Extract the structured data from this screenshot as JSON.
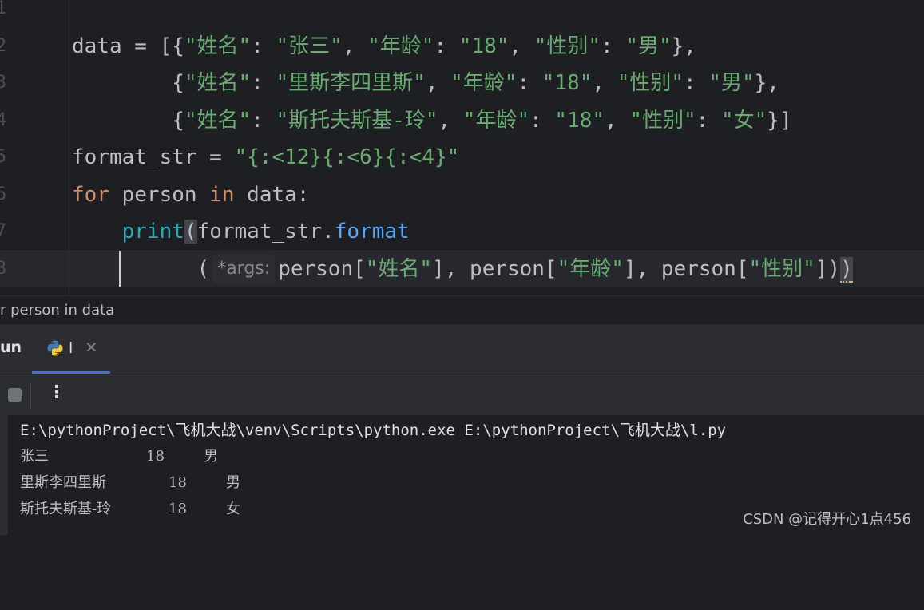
{
  "editor": {
    "line_numbers": [
      "1",
      "2",
      "3",
      "4",
      "5",
      "6",
      "7",
      "8"
    ],
    "code": {
      "l2": {
        "p1": "data = [{",
        "k1": "\"姓名\"",
        "c1": ": ",
        "v1": "\"张三\"",
        "c2": ", ",
        "k2": "\"年龄\"",
        "c3": ": ",
        "v2": "\"18\"",
        "c4": ", ",
        "k3": "\"性别\"",
        "c5": ": ",
        "v3": "\"男\"",
        "c6": "},"
      },
      "l3": {
        "p1": "        {",
        "k1": "\"姓名\"",
        "c1": ": ",
        "v1": "\"里斯李四里斯\"",
        "c2": ", ",
        "k2": "\"年龄\"",
        "c3": ": ",
        "v2": "\"18\"",
        "c4": ", ",
        "k3": "\"性别\"",
        "c5": ": ",
        "v3": "\"男\"",
        "c6": "},"
      },
      "l4": {
        "p1": "        {",
        "k1": "\"姓名\"",
        "c1": ": ",
        "v1": "\"斯托夫斯基-玲\"",
        "c2": ", ",
        "k2": "\"年龄\"",
        "c3": ": ",
        "v2": "\"18\"",
        "c4": ", ",
        "k3": "\"性别\"",
        "c5": ": ",
        "v3": "\"女\"",
        "c6": "}]"
      },
      "l5": {
        "p1": "format_str = ",
        "s1": "\"{:<12}{:<6}{:<4}\""
      },
      "l6": {
        "kw1": "for",
        "p1": " person ",
        "kw2": "in",
        "p2": " data:"
      },
      "l7": {
        "indent": "    ",
        "fn": "print",
        "paren": "(",
        "p1": "format_str.",
        "m1": "format"
      },
      "l8": {
        "indent": "          ",
        "p1": "(",
        "hint": "*args:",
        "p2": "person[",
        "s1": "\"姓名\"",
        "p3": "], person[",
        "s2": "\"年龄\"",
        "p4": "], person[",
        "s3": "\"性别\"",
        "p5": "]",
        "p6": ")",
        "p7": ")"
      }
    }
  },
  "breadcrumb": {
    "text": "r person in data"
  },
  "toolwindow": {
    "run_label": "un",
    "tab_name": "l",
    "tab_close": "✕"
  },
  "toolbar": {
    "more": "⋮"
  },
  "console": {
    "command": "E:\\pythonProject\\飞机大战\\venv\\Scripts\\python.exe E:\\pythonProject\\飞机大战\\l.py",
    "rows": [
      {
        "name": "张三",
        "age": "18",
        "gender": "男"
      },
      {
        "name": "里斯李四里斯",
        "age": "18",
        "gender": "男"
      },
      {
        "name": "斯托夫斯基-玲",
        "age": "18",
        "gender": "女"
      }
    ]
  },
  "watermark": "CSDN @记得开心1点456",
  "colors": {
    "background": "#1e1f22",
    "keyword": "#cf8e6d",
    "string": "#6aab73",
    "method": "#56a8f5",
    "builtin": "#2aacb8",
    "tab_accent": "#3574f0"
  }
}
